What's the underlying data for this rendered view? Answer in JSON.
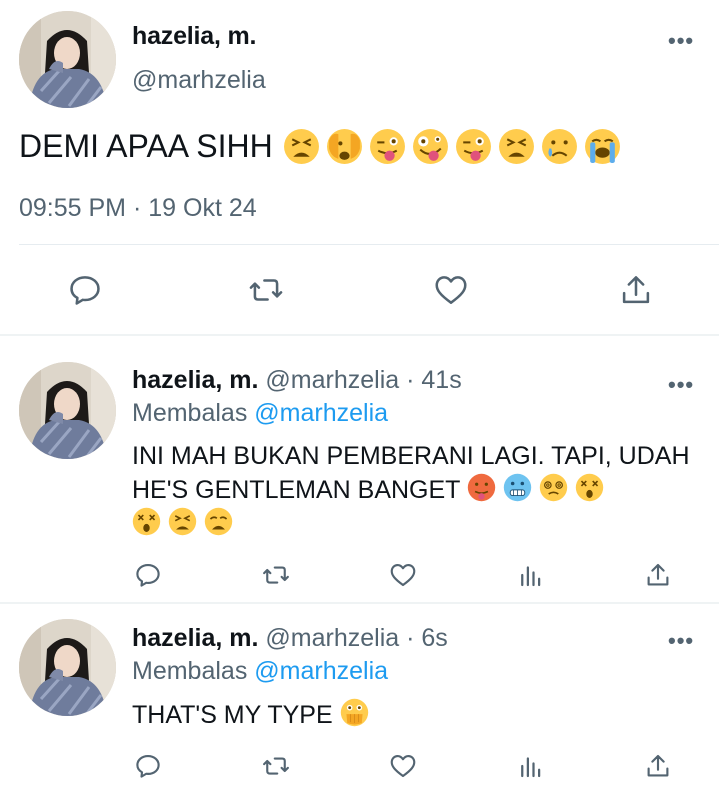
{
  "main_tweet": {
    "display_name": "hazelia, m.",
    "handle": "@marhzelia",
    "text": "DEMI APAA SIHH",
    "emojis": [
      "tired-face",
      "face-with-peeking-eye",
      "winking-tongue",
      "zany-face",
      "winking-tongue",
      "tired-face",
      "crying-face",
      "loudly-crying-face"
    ],
    "time": "09:55 PM",
    "date": "19 Okt 24",
    "meta_separator": "·",
    "more_label": "•••"
  },
  "replies": [
    {
      "display_name": "hazelia, m.",
      "handle": "@marhzelia",
      "separator": "·",
      "age": "41s",
      "replying_prefix": "Membalas",
      "replying_to": "@marhzelia",
      "text": "INI MAH BUKAN PEMBERANI LAGI. TAPI, UDAH HE'S GENTLEMAN BANGET",
      "emojis_line1": [
        "hot-face",
        "cold-face",
        "face-with-spiral-eyes",
        "dizzy-face"
      ],
      "emojis_line2": [
        "dizzy-face",
        "tired-face",
        "weary-face"
      ],
      "more_label": "•••"
    },
    {
      "display_name": "hazelia, m.",
      "handle": "@marhzelia",
      "separator": "·",
      "age": "6s",
      "replying_prefix": "Membalas",
      "replying_to": "@marhzelia",
      "text": "THAT'S MY TYPE",
      "emojis_line1": [
        "face-with-open-eyes-hand-over-mouth"
      ],
      "more_label": "•••"
    }
  ],
  "icons": {
    "reply": "reply-bubble-icon",
    "retweet": "retweet-icon",
    "like": "heart-icon",
    "share": "share-upload-icon",
    "views": "views-bar-chart-icon",
    "more": "more-dots-icon"
  },
  "colors": {
    "text": "#0f1419",
    "secondary": "#536471",
    "link": "#1d9bf0",
    "emoji": "#ffcc4d"
  }
}
